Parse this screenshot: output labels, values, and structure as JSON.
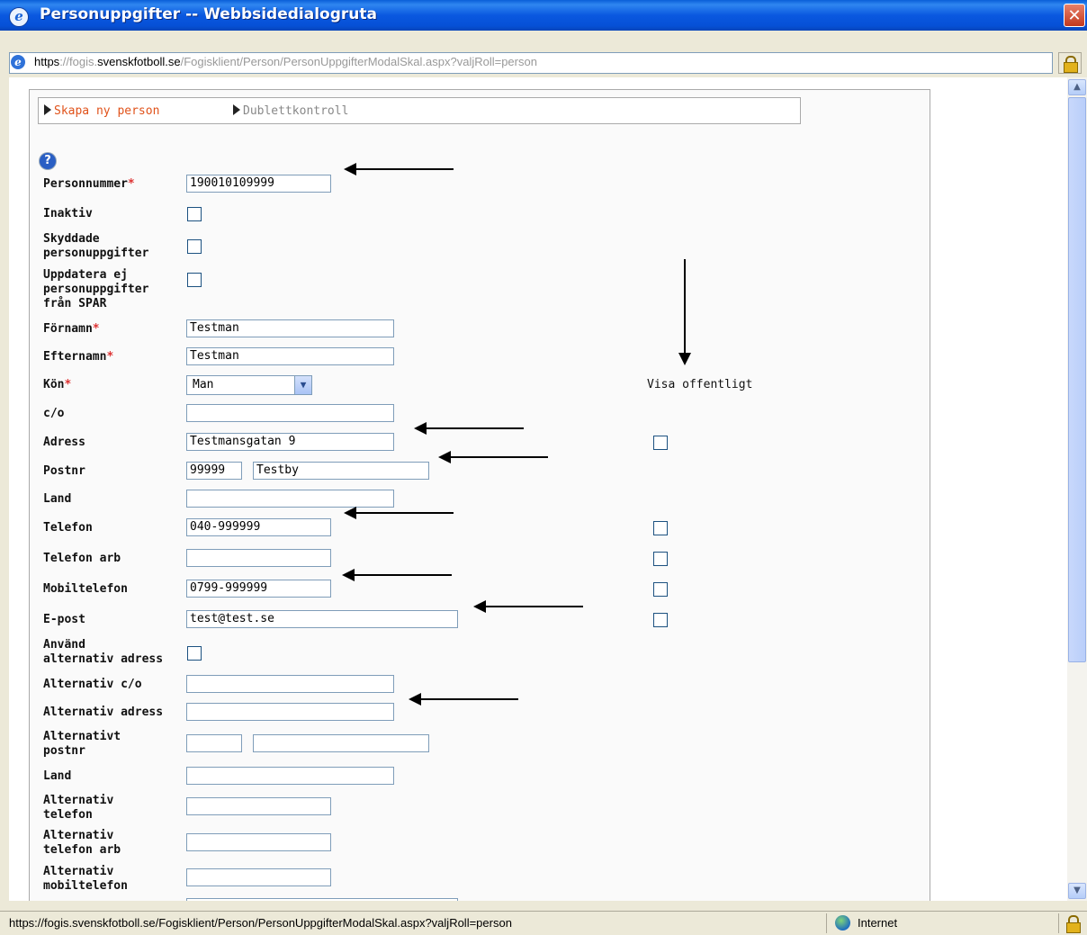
{
  "window": {
    "title": "Personuppgifter -- Webbsidedialogruta",
    "close_label": "✕"
  },
  "address": {
    "scheme": "https",
    "sep": "://fogis.",
    "domain": "svenskfotboll.se",
    "path": "/Fogisklient/Person/PersonUppgifterModalSkal.aspx?valjRoll=person"
  },
  "menu": {
    "create": "Skapa ny person",
    "duplicate": "Dublettkontroll"
  },
  "help_icon_glyph": "?",
  "colors": {
    "menu_create": "#e0521a",
    "menu_duplicate": "#888888",
    "required": "#dd3333"
  },
  "form": {
    "personnummer": {
      "label": "Personnummer",
      "req": "*",
      "value": "190010109999"
    },
    "inaktiv": {
      "label": "Inaktiv"
    },
    "skyddade": {
      "line1": "Skyddade",
      "line2": "personuppgifter"
    },
    "uppdatera": {
      "line1": "Uppdatera ej",
      "line2": "personuppgifter",
      "line3": "från SPAR"
    },
    "fornamn": {
      "label": "Förnamn",
      "req": "*",
      "value": "Testman"
    },
    "efternamn": {
      "label": "Efternamn",
      "req": "*",
      "value": "Testman"
    },
    "kon": {
      "label": "Kön",
      "req": "*",
      "value": "Man"
    },
    "visa_offentligt": "Visa offentligt",
    "co": {
      "label": "c/o",
      "value": ""
    },
    "adress": {
      "label": "Adress",
      "value": "Testmansgatan 9"
    },
    "postnr": {
      "label": "Postnr",
      "value": "99999",
      "city": "Testby"
    },
    "land": {
      "label": "Land",
      "value": ""
    },
    "telefon": {
      "label": "Telefon",
      "value": "040-999999"
    },
    "telefon_arb": {
      "label": "Telefon arb",
      "value": ""
    },
    "mobiltelefon": {
      "label": "Mobiltelefon",
      "value": "0799-999999"
    },
    "epost": {
      "label": "E-post",
      "value": "test@test.se"
    },
    "anvand_alt": {
      "line1": "Använd",
      "line2": "alternativ adress"
    },
    "alt_co": {
      "label": "Alternativ c/o",
      "value": ""
    },
    "alt_adress": {
      "label": "Alternativ adress",
      "value": ""
    },
    "alt_postnr": {
      "line1": "Alternativt",
      "line2": "postnr",
      "value": "",
      "city": ""
    },
    "alt_land": {
      "label": "Land",
      "value": ""
    },
    "alt_telefon": {
      "line1": "Alternativ",
      "line2": "telefon",
      "value": ""
    },
    "alt_telefon_arb": {
      "line1": "Alternativ",
      "line2": "telefon arb",
      "value": ""
    },
    "alt_mobil": {
      "line1": "Alternativ",
      "line2": "mobiltelefon",
      "value": ""
    }
  },
  "status": {
    "url": "https://fogis.svenskfotboll.se/Fogisklient/Person/PersonUppgifterModalSkal.aspx?valjRoll=person",
    "zone": "Internet"
  }
}
